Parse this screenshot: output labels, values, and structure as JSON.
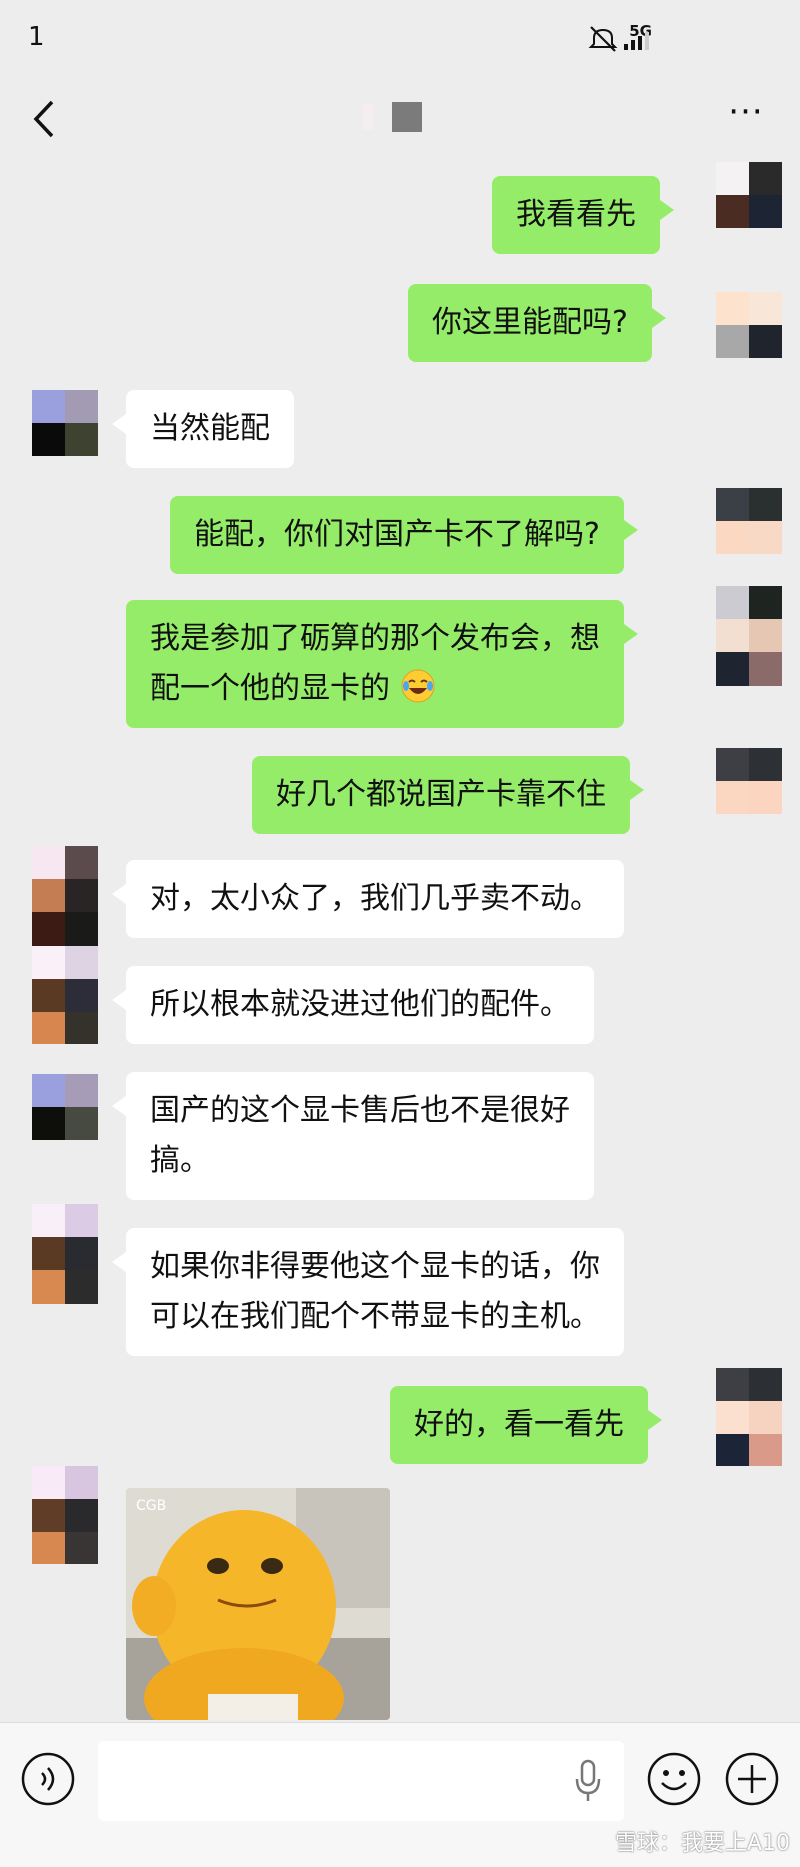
{
  "status_bar": {
    "time": "1",
    "network": "5G"
  },
  "nav": {
    "more_label": "···"
  },
  "messages": [
    {
      "side": "me",
      "text": "我看看先"
    },
    {
      "side": "me",
      "text": "你这里能配吗?"
    },
    {
      "side": "them",
      "text": "当然能配"
    },
    {
      "side": "me",
      "text": "能配，你们对国产卡不了解吗?"
    },
    {
      "side": "me",
      "line1": "我是参加了砺算的那个发布会，想",
      "line2": "配一个他的显卡的",
      "emoji": "laughing-crying-emoji"
    },
    {
      "side": "me",
      "text": "好几个都说国产卡靠不住"
    },
    {
      "side": "them",
      "text": "对，太小众了，我们几乎卖不动。"
    },
    {
      "side": "them",
      "text": "所以根本就没进过他们的配件。"
    },
    {
      "side": "them",
      "line1": "国产的这个显卡售后也不是很好",
      "line2": "搞。"
    },
    {
      "side": "them",
      "line1": "如果你非得要他这个显卡的话，你",
      "line2": "可以在我们配个不带显卡的主机。"
    },
    {
      "side": "me",
      "text": "好的，看一看先"
    }
  ],
  "sticker": {
    "corner_text": "CGB"
  },
  "watermark": "雪球：我要上A10",
  "colors": {
    "my_bubble": "#95ec69",
    "their_bubble": "#ffffff",
    "background": "#ededed"
  }
}
